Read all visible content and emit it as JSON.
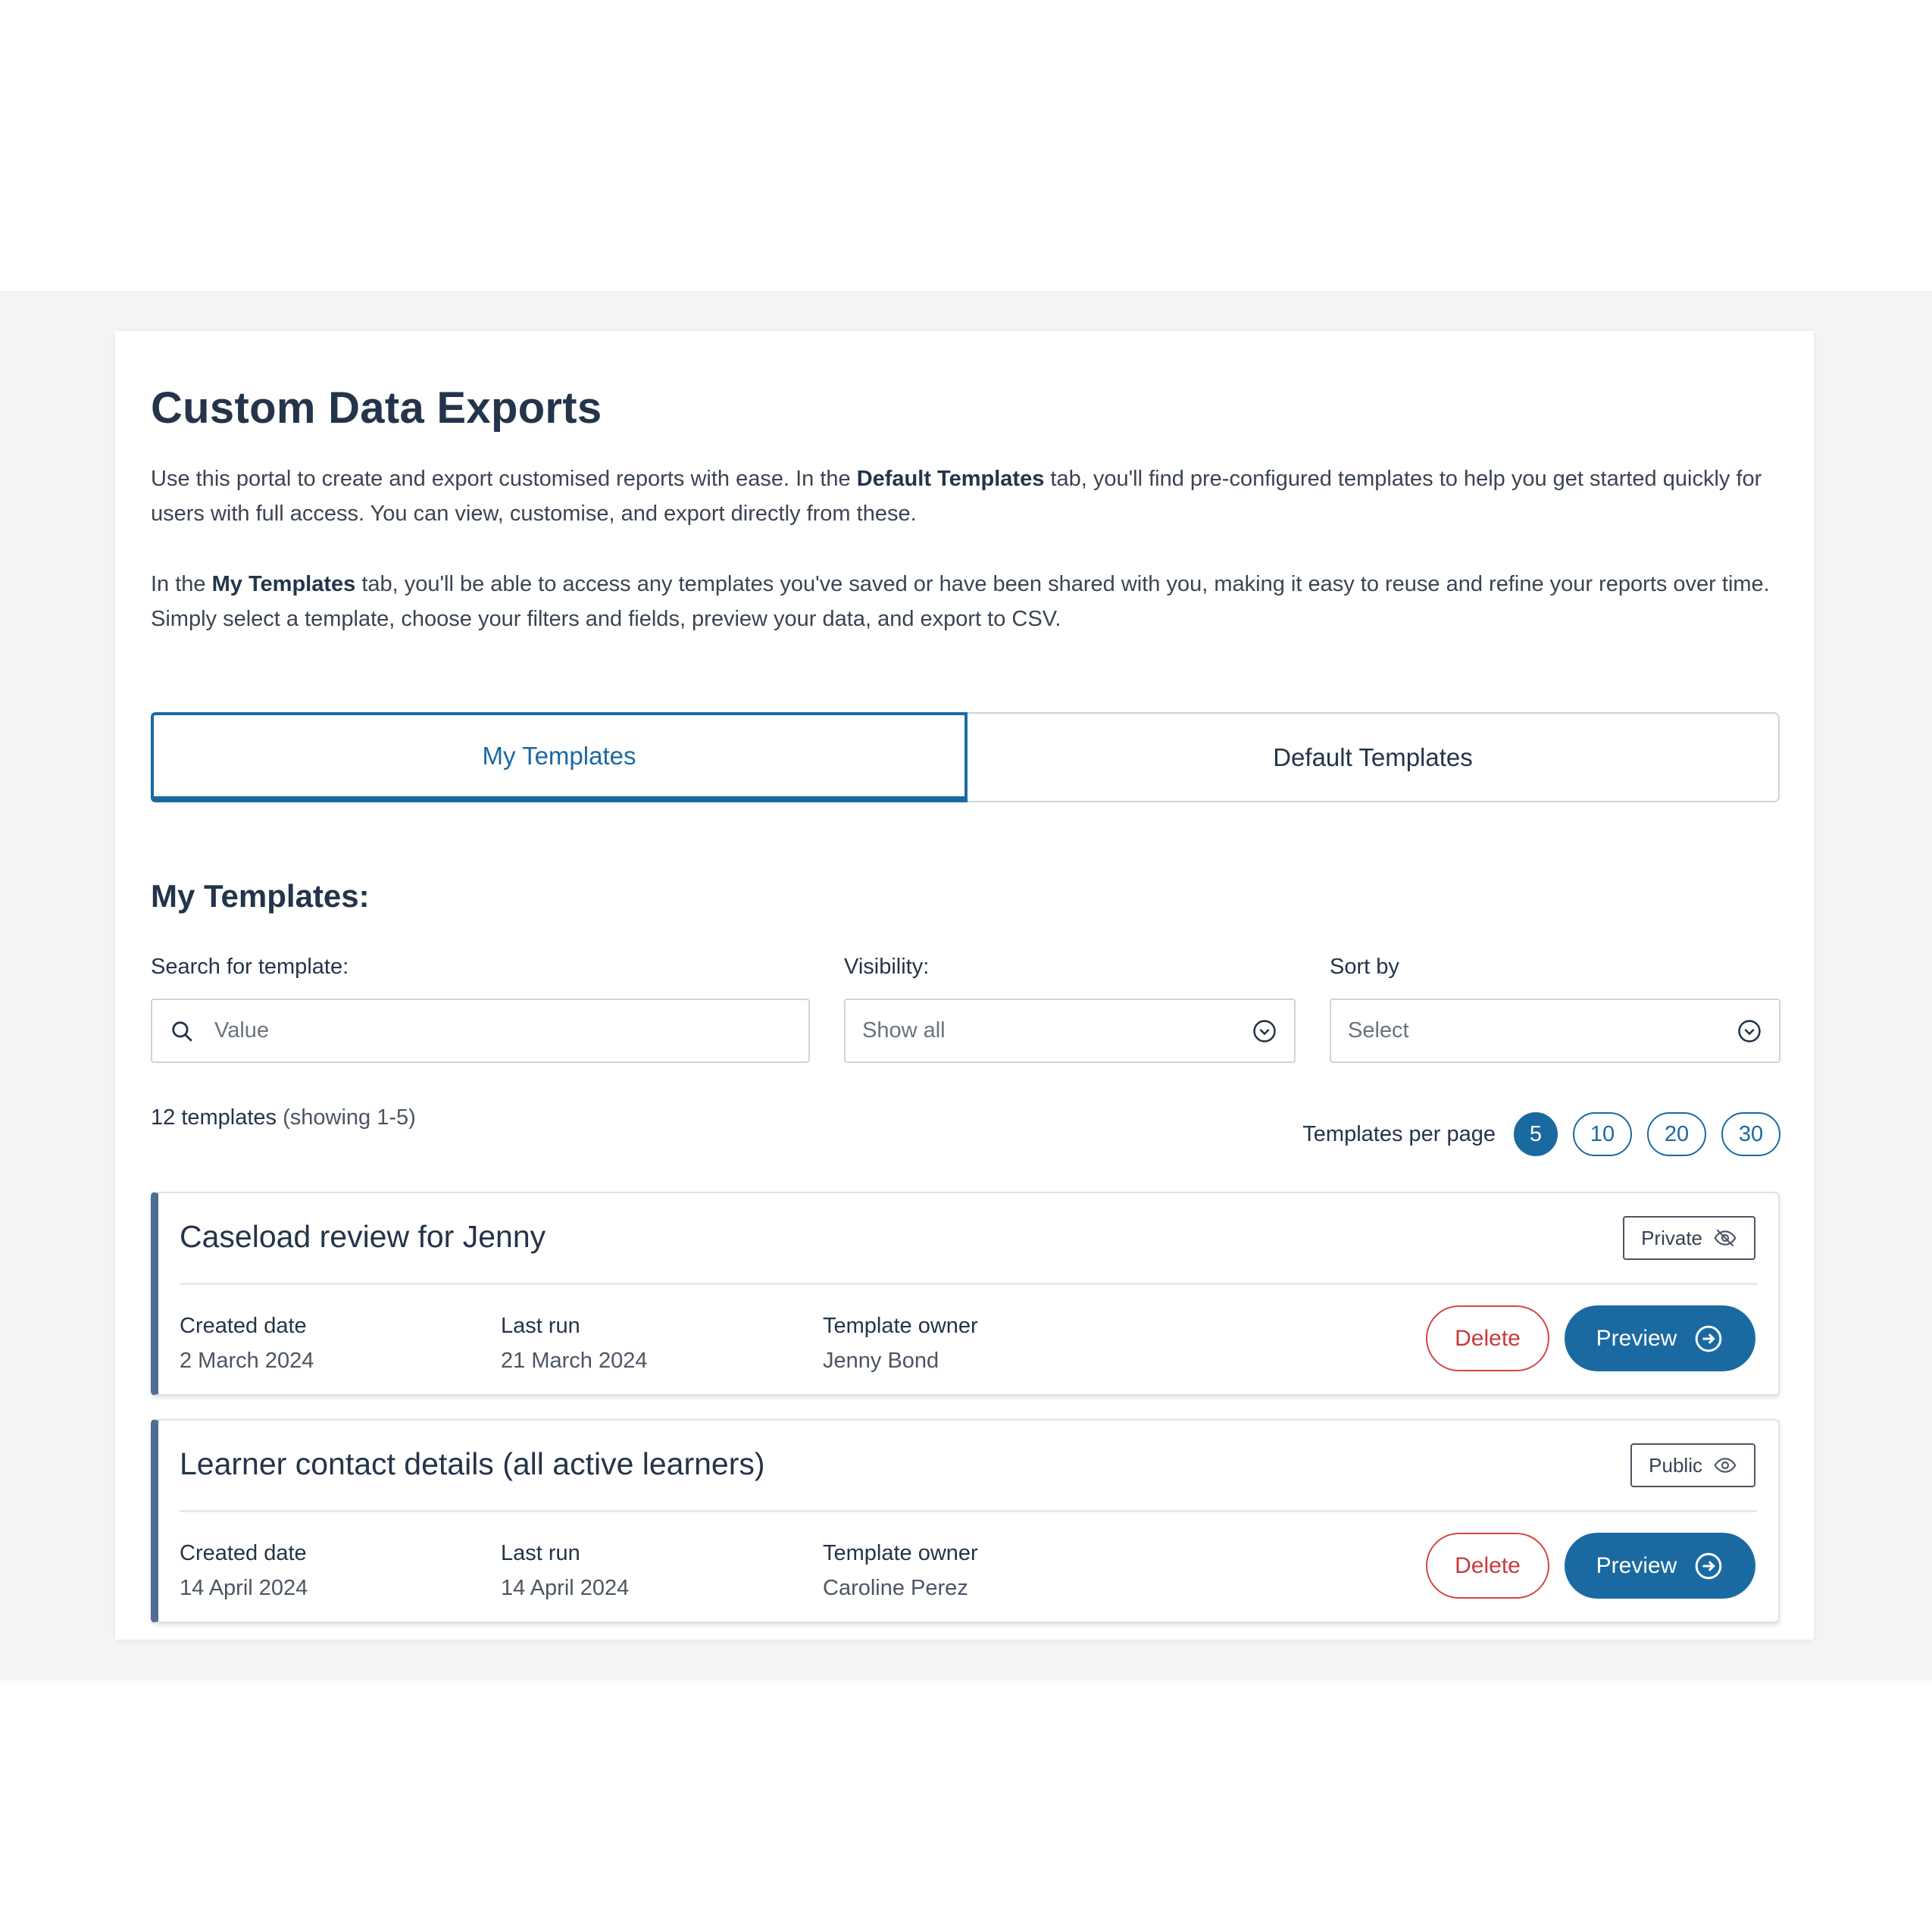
{
  "page": {
    "title": "Custom Data Exports",
    "intro_1": {
      "a": "Use this portal to create and export customised reports with ease. In the ",
      "b": "Default Templates",
      "c": " tab, you'll find pre-configured templates to help you get started quickly for users with full access. You can view, customise, and export directly from these."
    },
    "intro_2": {
      "a": "In the ",
      "b": "My Templates",
      "c": " tab, you'll be able to access any templates you've saved or have been shared with you, making it easy to reuse and refine your reports over time. Simply select a template, choose your filters and fields, preview your data, and export to CSV."
    }
  },
  "tabs": [
    {
      "label": "My Templates",
      "active": true
    },
    {
      "label": "Default Templates",
      "active": false
    }
  ],
  "section": {
    "title": "My Templates:"
  },
  "filters": {
    "search": {
      "label": "Search for template:",
      "placeholder": "Value"
    },
    "visibility": {
      "label": "Visibility:",
      "value": "Show all"
    },
    "sort": {
      "label": "Sort by",
      "value": "Select"
    }
  },
  "results": {
    "count": "12 templates",
    "showing": "(showing 1-5)",
    "per_page_label": "Templates per page",
    "per_page_options": [
      "5",
      "10",
      "20",
      "30"
    ],
    "per_page_selected": "5"
  },
  "templates": [
    {
      "title": "Caseload review for Jenny",
      "visibility": "Private",
      "visibility_icon": "eye-off-icon",
      "created_label": "Created date",
      "created": "2 March 2024",
      "last_run_label": "Last run",
      "last_run": "21 March 2024",
      "owner_label": "Template owner",
      "owner": "Jenny Bond",
      "delete_label": "Delete",
      "preview_label": "Preview"
    },
    {
      "title": "Learner contact details (all active learners)",
      "visibility": "Public",
      "visibility_icon": "eye-icon",
      "created_label": "Created date",
      "created": "14 April 2024",
      "last_run_label": "Last run",
      "last_run": "14 April 2024",
      "owner_label": "Template owner",
      "owner": "Caroline Perez",
      "delete_label": "Delete",
      "preview_label": "Preview"
    }
  ],
  "colors": {
    "primary": "#1a6aa1",
    "heading": "#24344a",
    "danger": "#d64545",
    "card_accent": "#4f6d8f",
    "background_band": "#f4f4f4"
  }
}
